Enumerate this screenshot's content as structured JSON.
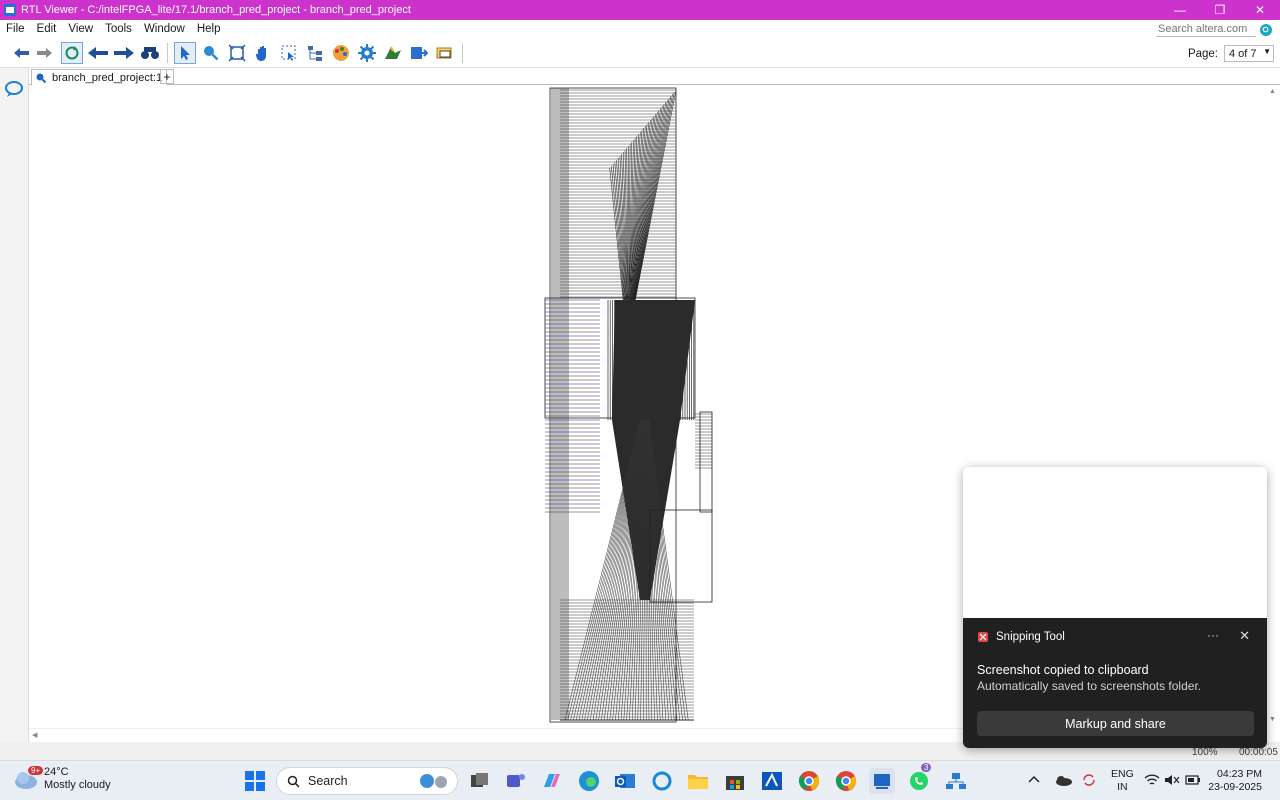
{
  "window": {
    "title": "RTL Viewer - C:/intelFPGA_lite/17.1/branch_pred_project - branch_pred_project",
    "controls": {
      "minimize": "—",
      "restore": "❐",
      "close": "✕"
    }
  },
  "menu": {
    "items": [
      "File",
      "Edit",
      "View",
      "Tools",
      "Window",
      "Help"
    ],
    "search_placeholder": "Search altera.com"
  },
  "toolbar": {
    "page_label": "Page:",
    "page_value": "4 of 7",
    "buttons": [
      "back-icon",
      "forward-icon",
      "refresh-icon",
      "previous-page-icon",
      "next-page-icon",
      "find-icon",
      "selection-tool-icon",
      "zoom-tool-icon",
      "fit-window-icon",
      "hand-tool-icon",
      "area-select-icon",
      "netlist-navigator-icon",
      "color-palette-icon",
      "settings-icon",
      "bird-icon",
      "export-icon",
      "property-icon"
    ]
  },
  "tabs": {
    "active_label": "branch_pred_project:1",
    "add_label": "+"
  },
  "status": {
    "zoom": "100%",
    "elapsed": "00:00:05"
  },
  "toast": {
    "app_name": "Snipping Tool",
    "more": "···",
    "close": "✕",
    "headline": "Screenshot copied to clipboard",
    "sub": "Automatically saved to screenshots folder.",
    "action": "Markup and share"
  },
  "taskbar": {
    "weather_temp": "24°C",
    "weather_desc": "Mostly cloudy",
    "weather_badge": "9+",
    "search_label": "Search",
    "teams_badge": "3",
    "lang_line1": "ENG",
    "lang_line2": "IN",
    "time": "04:23 PM",
    "date": "23-09-2025"
  }
}
